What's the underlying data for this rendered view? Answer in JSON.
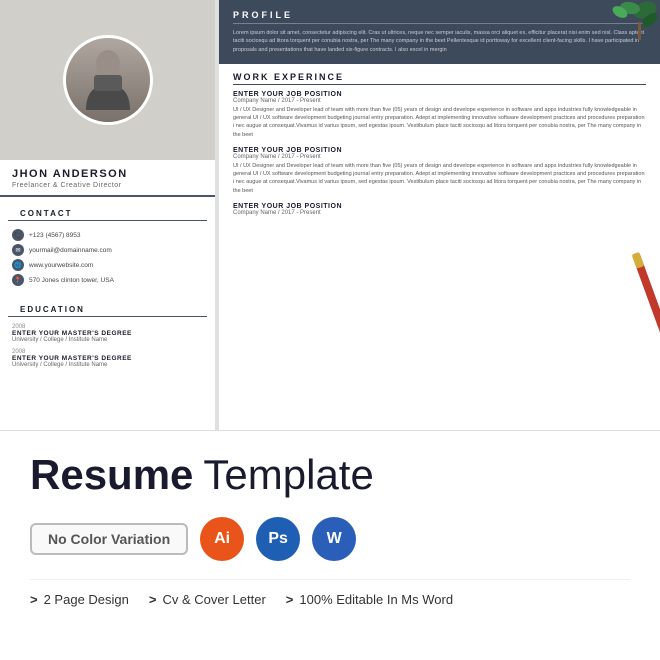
{
  "resume": {
    "person": {
      "name": "JHON ANDERSON",
      "title": "Freelancer & Creative Director"
    },
    "contact": {
      "heading": "CONTACT",
      "items": [
        {
          "icon": "phone",
          "text": "+123 (4567) 8953"
        },
        {
          "icon": "email",
          "text": "yourmail@domainname.com"
        },
        {
          "icon": "web",
          "text": "www.yourwebsite.com"
        },
        {
          "icon": "location",
          "text": "570 Jones clinton tower, USA"
        }
      ]
    },
    "education": {
      "heading": "EDUCATION",
      "items": [
        {
          "year": "2008",
          "degree": "ENTER YOUR MASTER'S DEGREE",
          "school": "University / College / Institute Name"
        },
        {
          "year": "2008",
          "degree": "ENTER YOUR MASTER'S DEGREE",
          "school": "University / College / Institute Name"
        }
      ]
    },
    "profile": {
      "heading": "PROFILE",
      "text": "Lorem ipsum dolor sit amet, consectetur adipiscing elit. Cras ut ultrices, neque nec semper iaculis, massa orci aliquet ex, efficitur placerat nisi enim sed nisl. Class aptent taciti sociosqu ad litora torquent per conubia nostra, per The many company in the beet Pellentesque id porttoway for excellent client-facing skills. I have participated in proposals and presentations that have landed six-figure contracts. I also excel in mergin"
    },
    "work": {
      "heading": "WORK EXPERINCE",
      "jobs": [
        {
          "position": "ENTER YOUR JOB POSITION",
          "company": "Company Name / 2017 - Present",
          "description": "UI / UX Designer and Developer lead of team with more than five (05) years of design and develope experience in software and apps industries fully knowledgeable in general UI / UX software development budgeting journal entry preparation. Adept at implementing innovative software development practices and procedures preparation i nec augue at consequat.Vivamus id varius ipsum, sed egestas ipsum. Vestibulum place taciti sociosqu ad litora torquent per conubia nostra, per The many company in the beet"
        },
        {
          "position": "ENTER YOUR JOB POSITION",
          "company": "Company Name / 2017 - Present",
          "description": "UI / UX Designer and Developer lead of team with more than five (05) years of design and develope experience in software and apps industries fully knowledgeable in general UI / UX software development budgeting journal entry preparation. Adept at implementing innovative software development practices and procedures preparation i nec augue at consequat.Vivamus id varius ipsum, sed egestas ipsum. Vestibulum place taciti sociosqu ad litora torquent per conubia nostra, per The many company in the beet"
        },
        {
          "position": "ENTER YOUR JOB POSITION",
          "company": "Company Name / 2017 - Present",
          "description": ""
        }
      ]
    }
  },
  "bottom": {
    "title_bold": "Resume",
    "title_light": "Template",
    "badge_text": "No Color Variation",
    "icons": [
      {
        "label": "Ai",
        "type": "ai"
      },
      {
        "label": "Ps",
        "type": "ps"
      },
      {
        "label": "W",
        "type": "word"
      }
    ],
    "features": [
      "> 2 Page Design",
      "> Cv & Cover Letter",
      "> 100% Editable In Ms Word"
    ]
  }
}
